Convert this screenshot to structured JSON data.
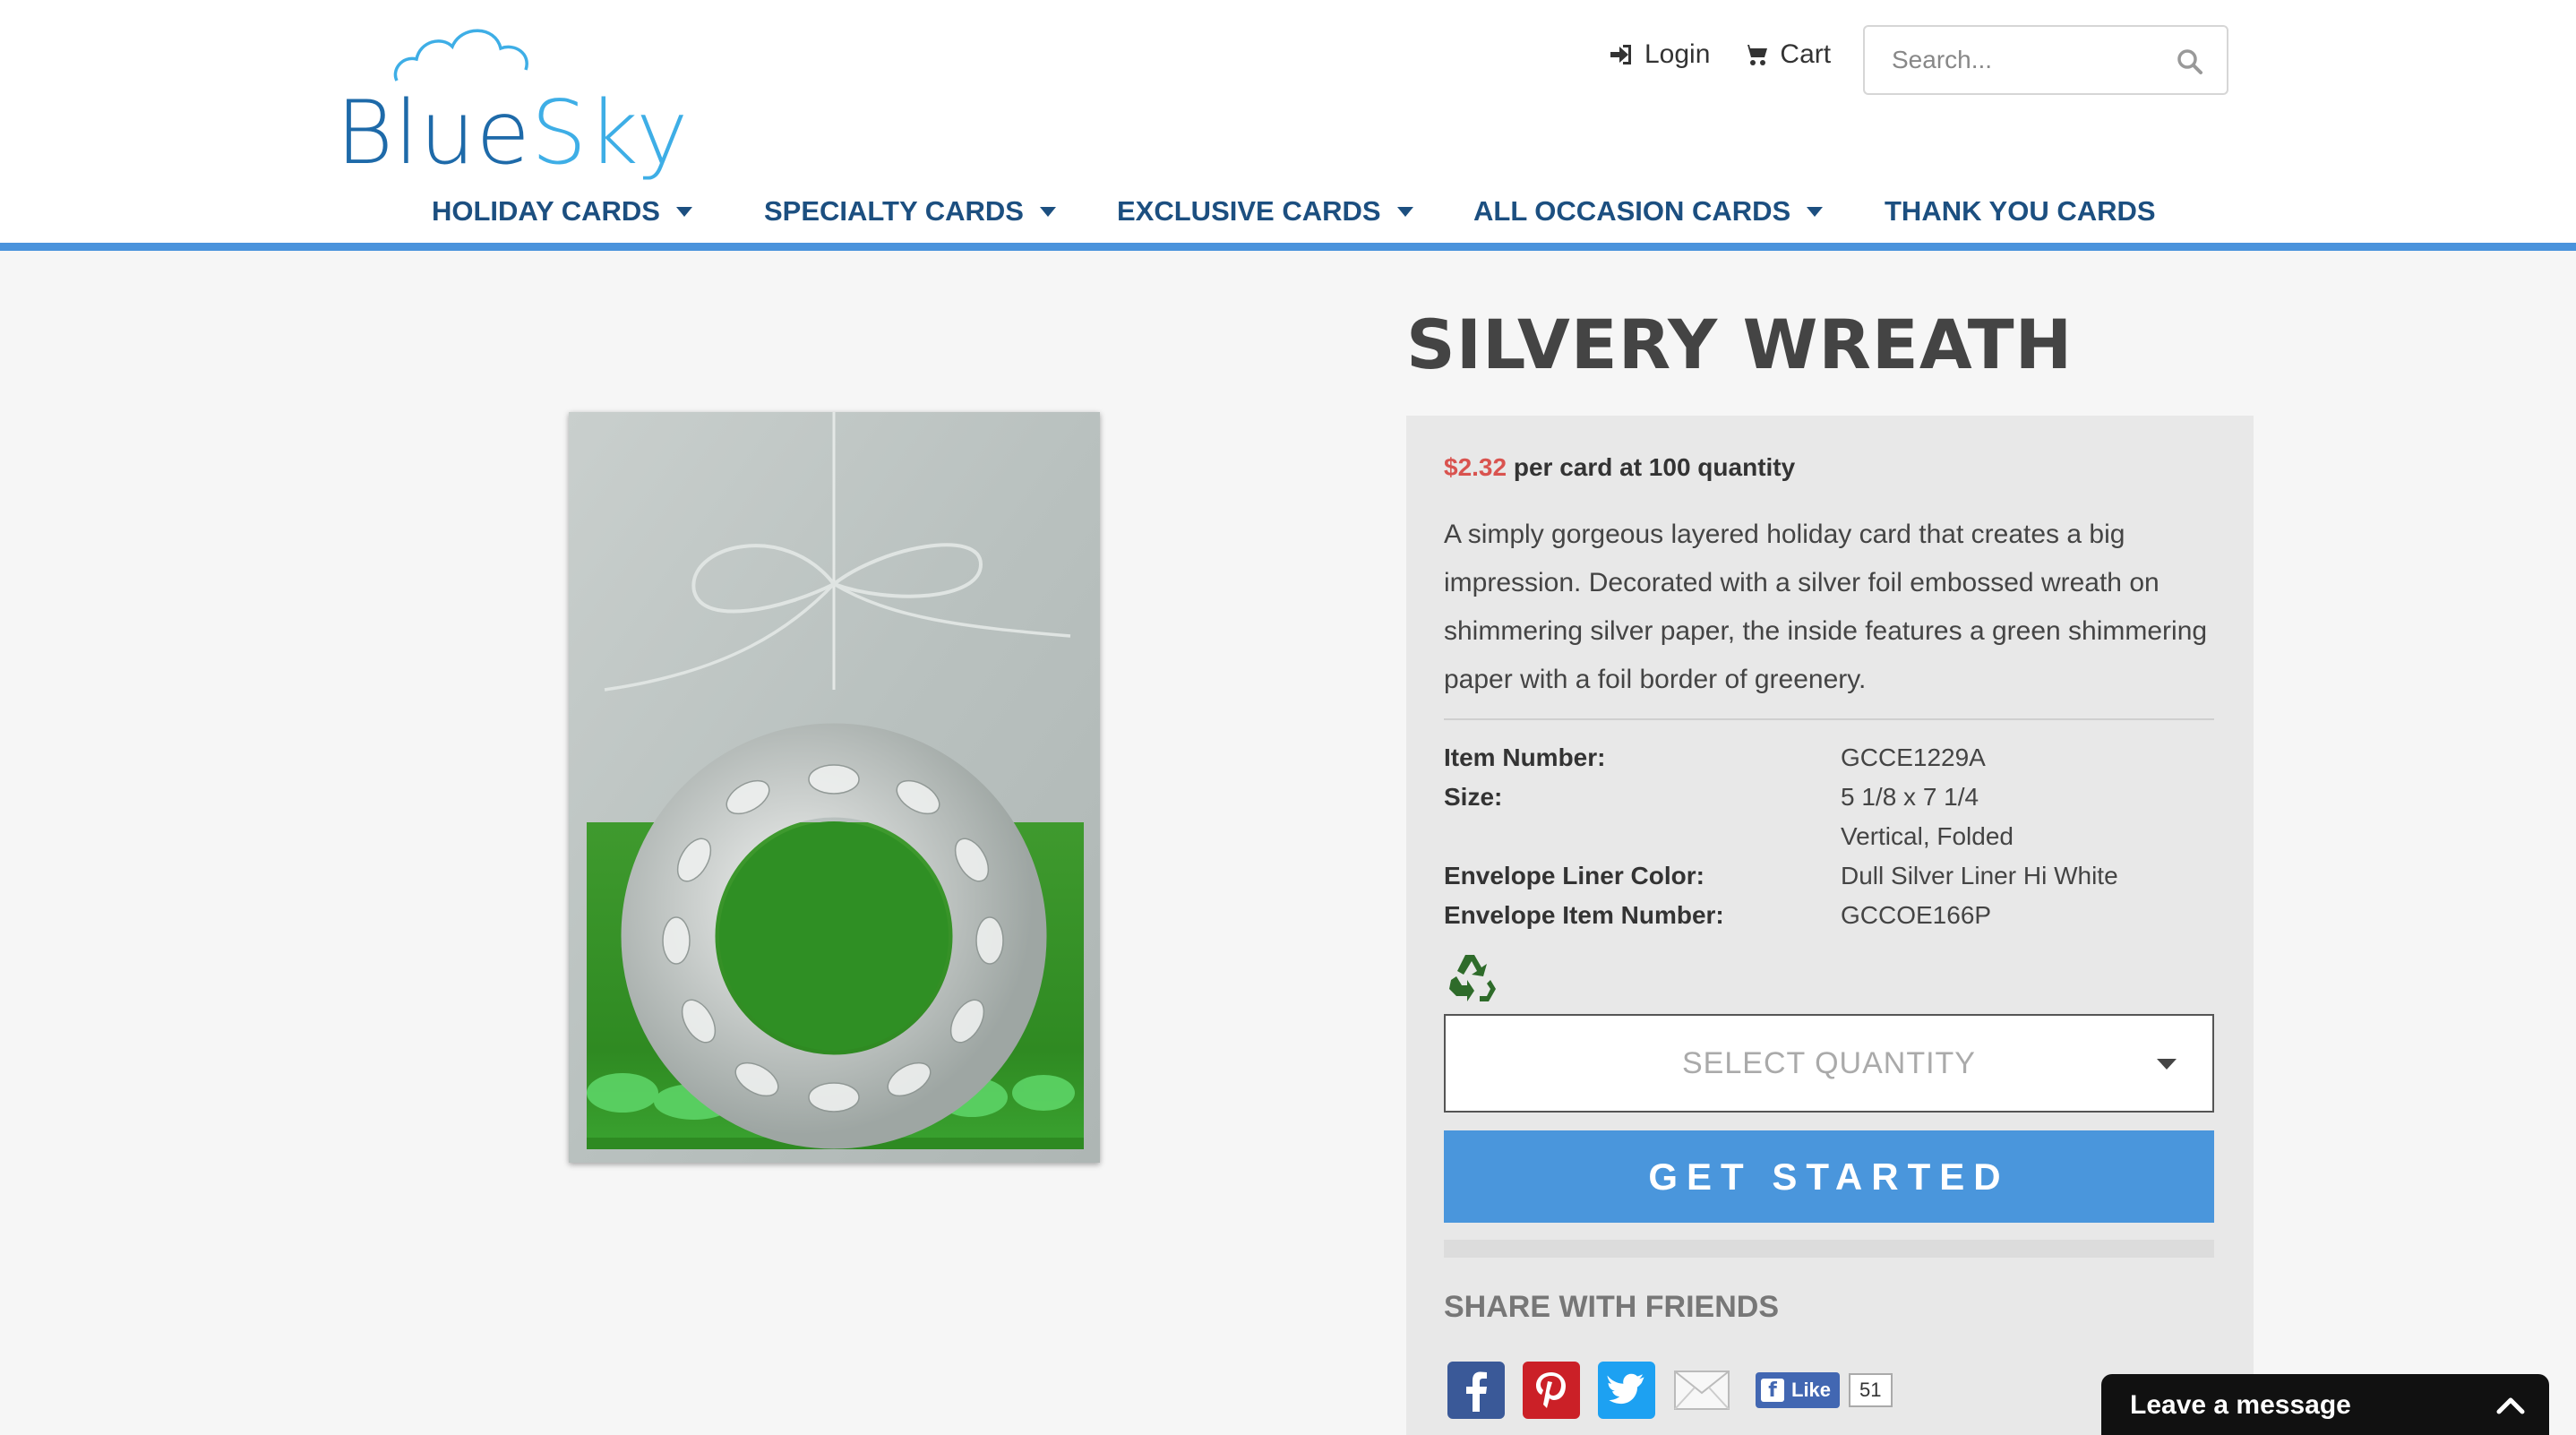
{
  "header": {
    "logo": {
      "word_blue": "Blue",
      "word_sky": "Sky"
    },
    "login_label": "Login",
    "cart_label": "Cart",
    "search_placeholder": "Search..."
  },
  "nav": {
    "items": [
      {
        "label": "HOLIDAY CARDS",
        "has_dropdown": true
      },
      {
        "label": "SPECIALTY CARDS",
        "has_dropdown": true
      },
      {
        "label": "EXCLUSIVE CARDS",
        "has_dropdown": true
      },
      {
        "label": "ALL OCCASION CARDS",
        "has_dropdown": true
      },
      {
        "label": "THANK YOU CARDS",
        "has_dropdown": false
      }
    ]
  },
  "product": {
    "title": "SILVERY WREATH",
    "price": "$2.32",
    "price_suffix": "per card at 100 quantity",
    "description": "A simply gorgeous layered holiday card that creates a big impression. Decorated with a silver foil embossed wreath on shimmering silver paper, the inside features a green shimmering paper with a foil border of greenery.",
    "specs": {
      "item_number_label": "Item Number:",
      "item_number": "GCCE1229A",
      "size_label": "Size:",
      "size_line1": "5 1/8 x 7 1/4",
      "size_line2": "Vertical, Folded",
      "envelope_liner_label": "Envelope Liner Color:",
      "envelope_liner": "Dull Silver Liner Hi White",
      "envelope_item_label": "Envelope Item Number:",
      "envelope_item": "GCCOE166P"
    },
    "select_quantity_label": "SELECT QUANTITY",
    "get_started_label": "GET STARTED"
  },
  "share": {
    "title": "SHARE WITH FRIENDS",
    "like_label": "Like",
    "like_count": "51"
  },
  "chat": {
    "label": "Leave a message"
  },
  "colors": {
    "accent": "#4a93dc",
    "nav_text": "#1c4f80",
    "price": "#d9534f",
    "button": "#4a96dc"
  }
}
